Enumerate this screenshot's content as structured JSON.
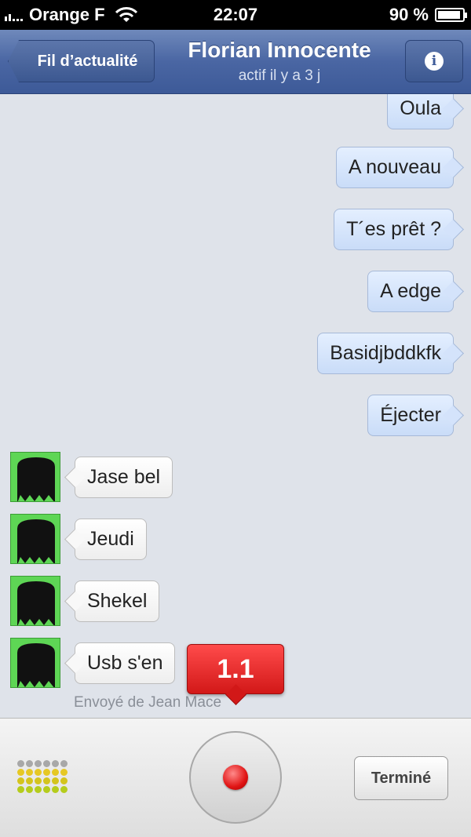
{
  "status_bar": {
    "carrier": "Orange F",
    "time": "22:07",
    "battery": "90 %"
  },
  "nav": {
    "back_label": "Fil d’actualité",
    "title": "Florian Innocente",
    "subtitle": "actif il y a 3 j",
    "info_icon": "info-icon"
  },
  "messages": {
    "outgoing": [
      "Oula",
      "A nouveau",
      "T´es prêt ?",
      "A edge",
      "Basidjbddkfk",
      "Éjecter"
    ],
    "incoming": [
      "Jase bel",
      "Jeudi",
      "Shekel",
      "Usb s'en"
    ]
  },
  "sent_from": "Envoyé de Jean Mace",
  "recorder": {
    "timer": "1.1",
    "done_label": "Terminé"
  },
  "colors": {
    "nav": "#4a66a3",
    "avatar": "#5ed655",
    "record": "#e01414",
    "outgoing_bubble": "#c9dcf8"
  }
}
